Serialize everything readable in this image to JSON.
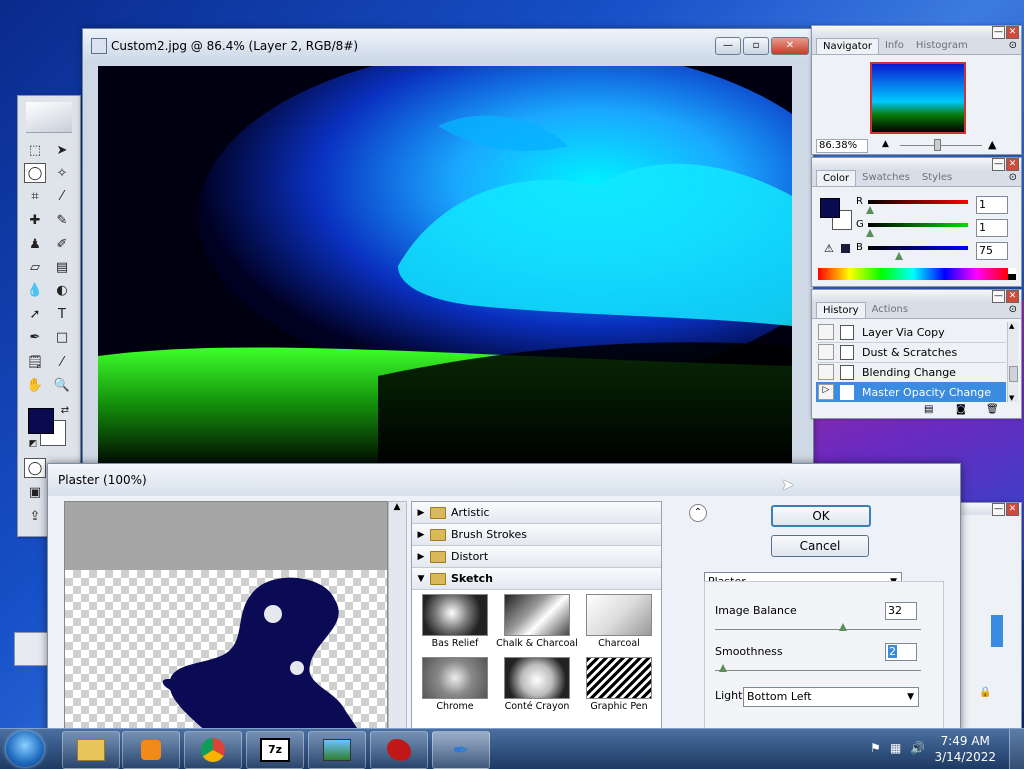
{
  "document": {
    "title": "Custom2.jpg @ 86.4% (Layer 2, RGB/8#)",
    "min": "—",
    "max": "▫",
    "close": "✕"
  },
  "navigator": {
    "tabs": [
      "Navigator",
      "Info",
      "Histogram"
    ],
    "zoom": "86.38%"
  },
  "color": {
    "tabs": [
      "Color",
      "Swatches",
      "Styles"
    ],
    "r_label": "R",
    "r_value": "1",
    "g_label": "G",
    "g_value": "1",
    "b_label": "B",
    "b_value": "75",
    "warning_icon": "⚠"
  },
  "history": {
    "tabs": [
      "History",
      "Actions"
    ],
    "items": [
      "Layer Via Copy",
      "Dust & Scratches",
      "Blending Change",
      "Master Opacity Change"
    ],
    "selected": "Master Opacity Change"
  },
  "dialog": {
    "title": "Plaster (100%)",
    "categories": [
      "Artistic",
      "Brush Strokes",
      "Distort"
    ],
    "open_category": "Sketch",
    "thumbs": [
      "Bas Relief",
      "Chalk & Charcoal",
      "Charcoal",
      "Chrome",
      "Conté Crayon",
      "Graphic Pen"
    ],
    "ok": "OK",
    "cancel": "Cancel",
    "filter": "Plaster",
    "image_balance_label": "Image Balance",
    "image_balance": "32",
    "smoothness_label": "Smoothness",
    "smoothness": "2",
    "light_label": "Light:",
    "light": "Bottom Left"
  },
  "taskbar": {
    "time": "7:49 AM",
    "date": "3/14/2022"
  },
  "colors": {
    "foreground": "#0a0a50",
    "history_selected": "#3b8be0"
  }
}
